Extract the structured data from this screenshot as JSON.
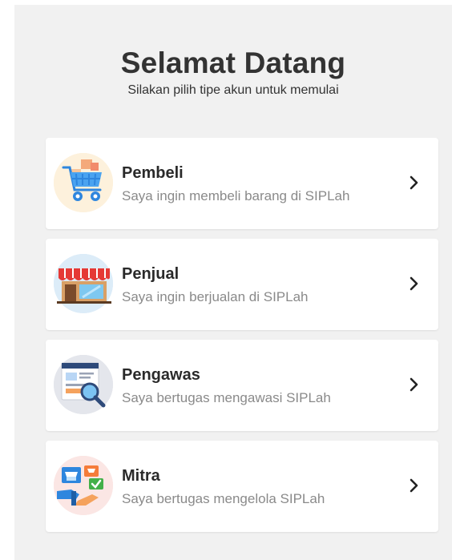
{
  "header": {
    "title": "Selamat Datang",
    "subtitle": "Silakan pilih tipe akun untuk memulai"
  },
  "account_types": [
    {
      "title": "Pembeli",
      "description": "Saya ingin membeli barang di SIPLah",
      "icon": "shopping-cart-icon"
    },
    {
      "title": "Penjual",
      "description": "Saya ingin berjualan di SIPLah",
      "icon": "storefront-icon"
    },
    {
      "title": "Pengawas",
      "description": "Saya bertugas mengawasi SIPLah",
      "icon": "inspect-magnifier-icon"
    },
    {
      "title": "Mitra",
      "description": "Saya bertugas mengelola SIPLah",
      "icon": "partner-handshake-icon"
    }
  ],
  "colors": {
    "panel_background": "#f1f1f1",
    "card_background": "#ffffff",
    "title_text": "#333333",
    "description_text": "#8a8a8a"
  }
}
